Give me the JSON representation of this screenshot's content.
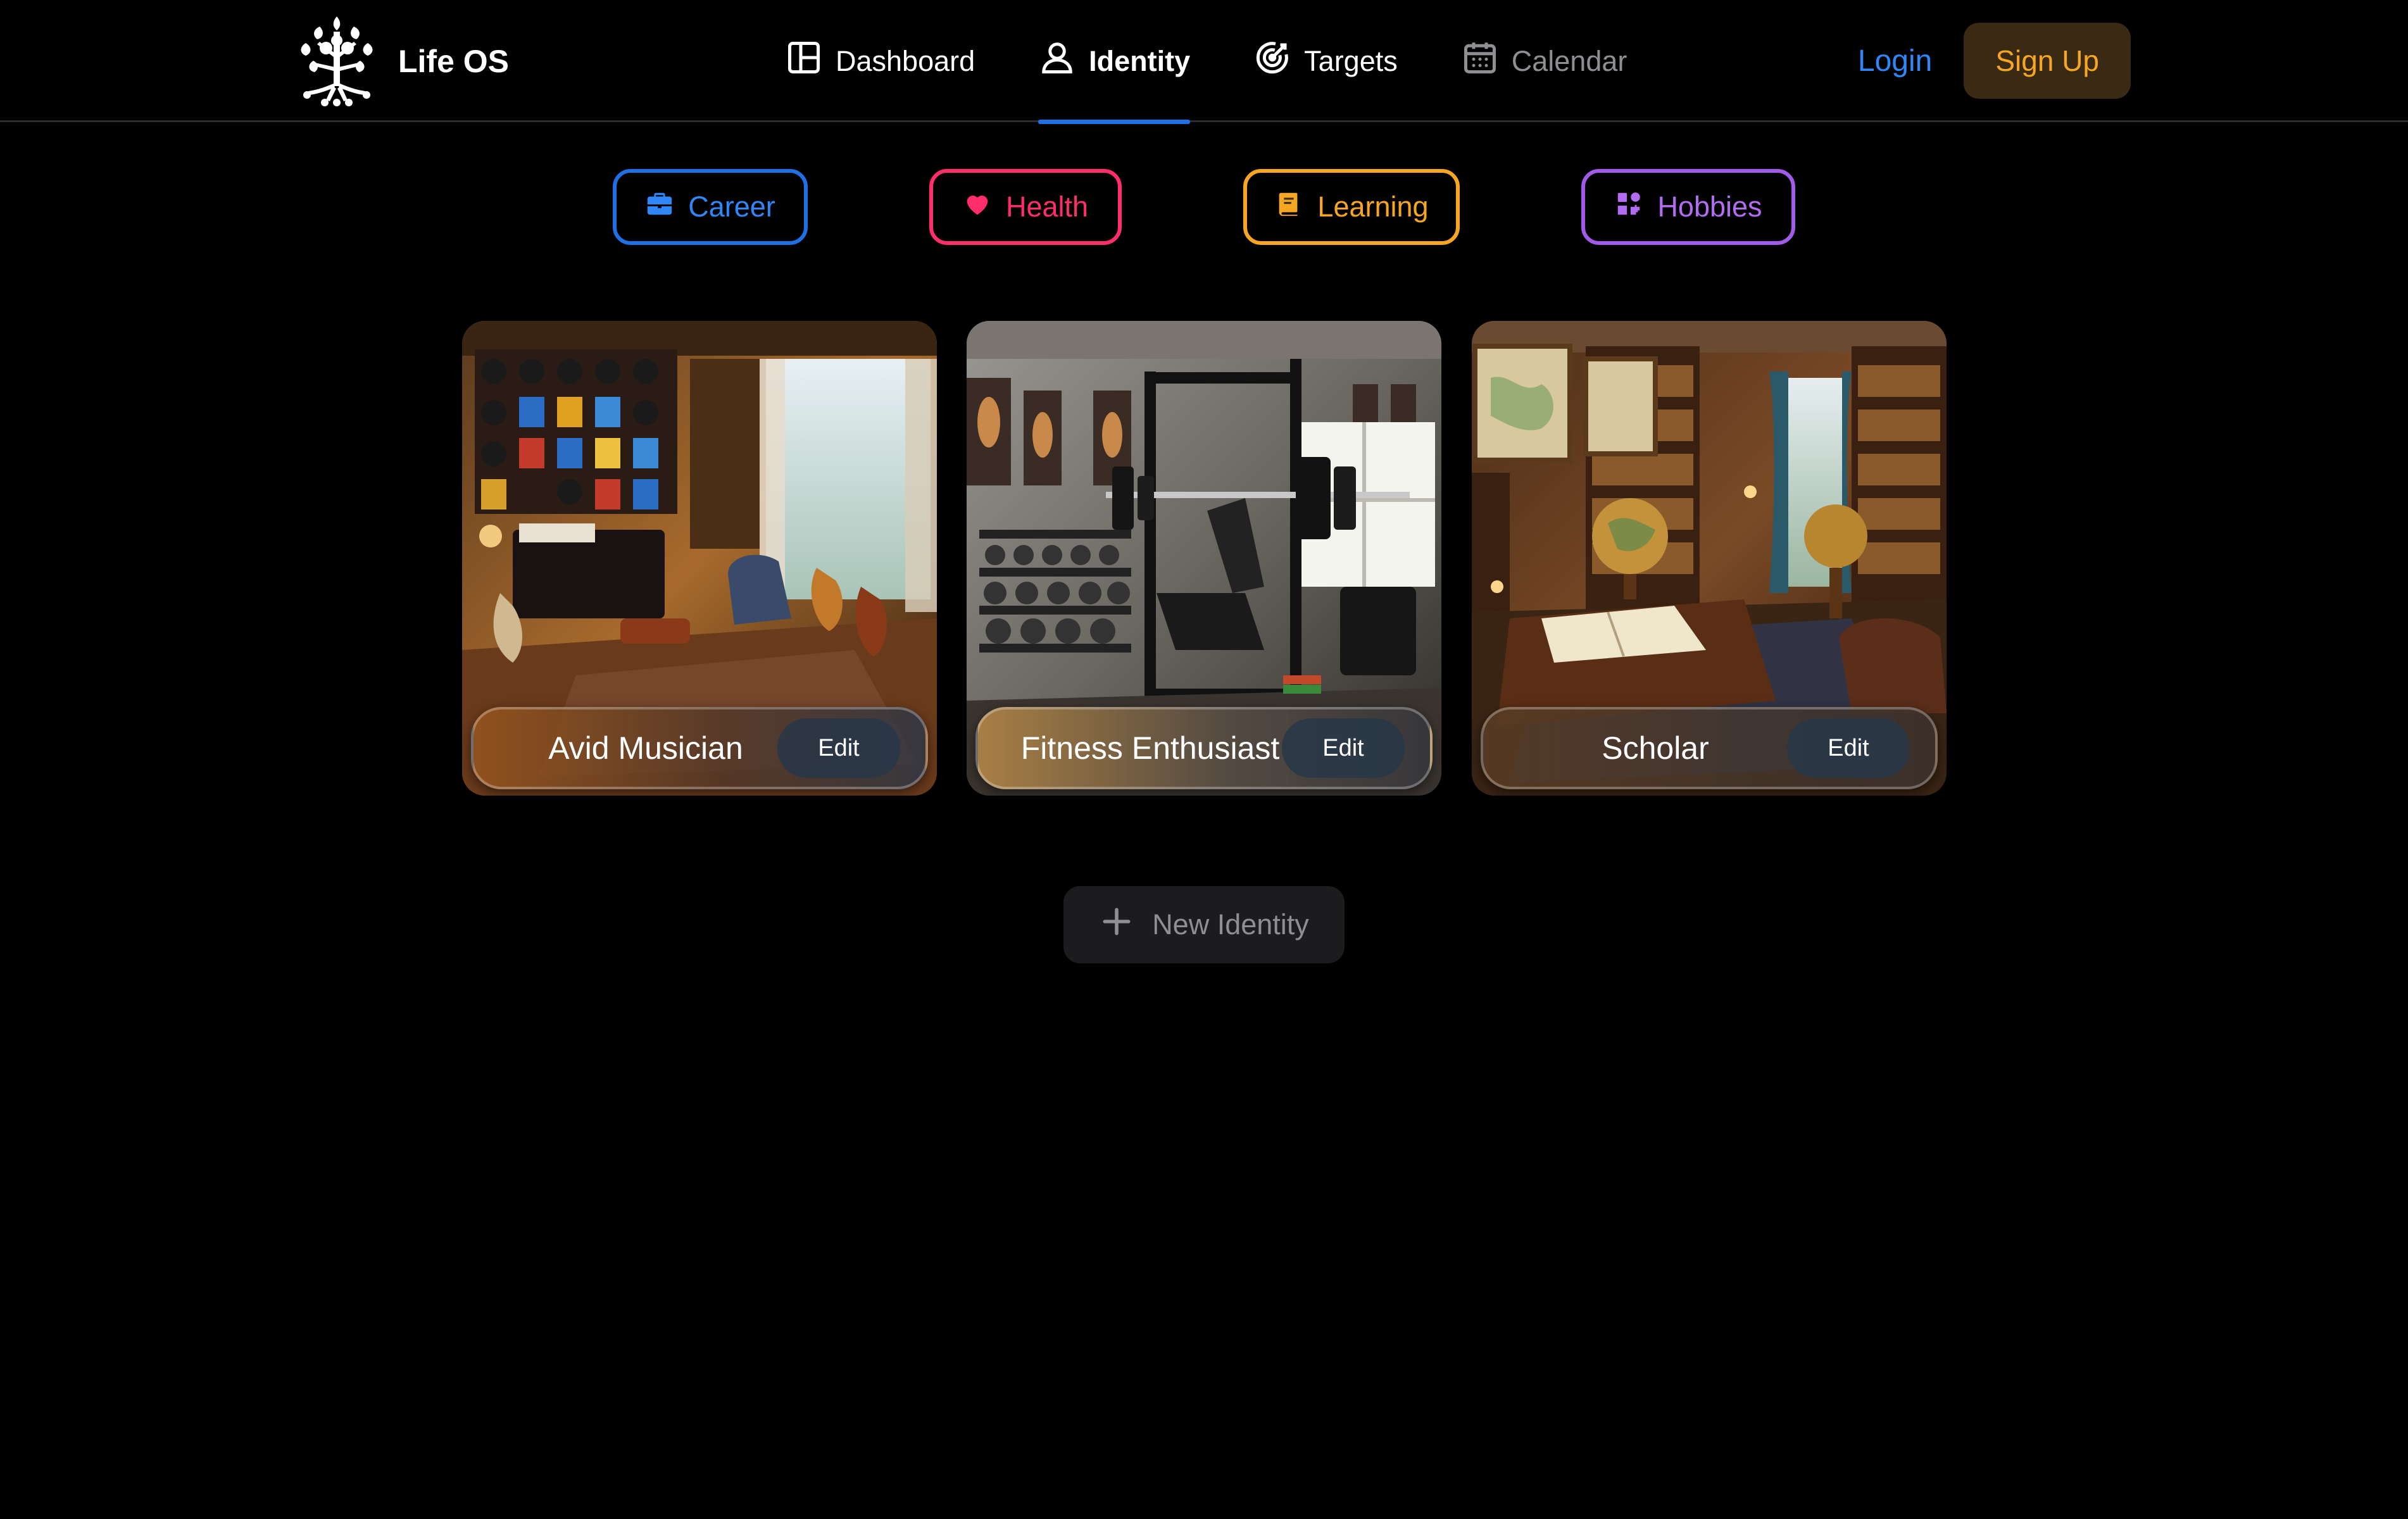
{
  "brand": {
    "name": "Life OS",
    "logo_icon": "tree-icon"
  },
  "nav": {
    "items": [
      {
        "label": "Dashboard",
        "icon": "layout-icon",
        "state": "default"
      },
      {
        "label": "Identity",
        "icon": "user-icon",
        "state": "active"
      },
      {
        "label": "Targets",
        "icon": "target-icon",
        "state": "default"
      },
      {
        "label": "Calendar",
        "icon": "calendar-icon",
        "state": "muted"
      }
    ]
  },
  "auth": {
    "login_label": "Login",
    "signup_label": "Sign Up"
  },
  "categories": [
    {
      "label": "Career",
      "icon": "briefcase-icon",
      "color": "#1f6fe5"
    },
    {
      "label": "Health",
      "icon": "heart-icon",
      "color": "#ff2d6a"
    },
    {
      "label": "Learning",
      "icon": "book-icon",
      "color": "#f6a623"
    },
    {
      "label": "Hobbies",
      "icon": "puzzle-icon",
      "color": "#a25ae8"
    }
  ],
  "identities": [
    {
      "title": "Avid Musician",
      "edit_label": "Edit",
      "image": "music-room-image"
    },
    {
      "title": "Fitness Enthusiast",
      "edit_label": "Edit",
      "image": "home-gym-image"
    },
    {
      "title": "Scholar",
      "edit_label": "Edit",
      "image": "library-image"
    }
  ],
  "new_identity": {
    "label": "New Identity",
    "icon": "plus-icon"
  },
  "colors": {
    "background": "#000000",
    "accent_blue": "#1f6fe5",
    "signup_text": "#f6a623",
    "signup_bg": "#3a2a14"
  }
}
